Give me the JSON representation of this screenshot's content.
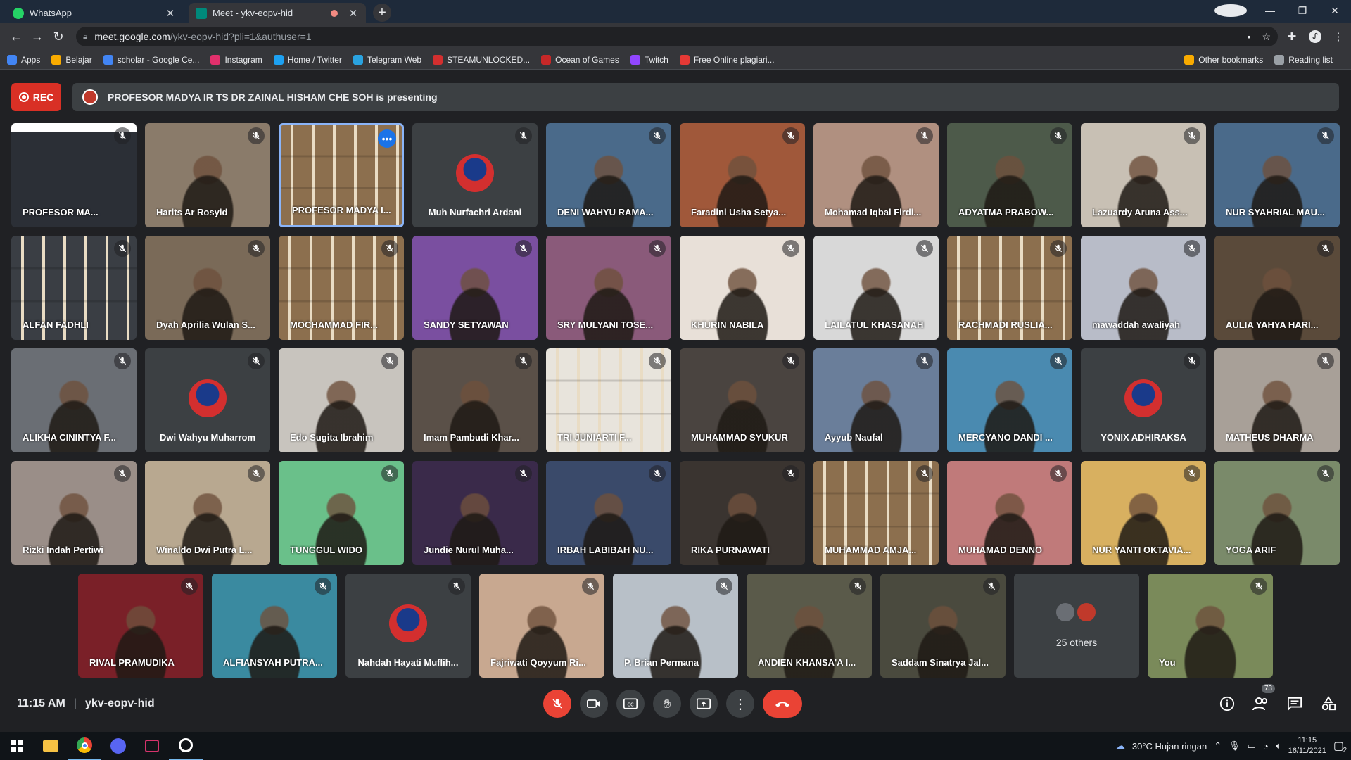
{
  "browser": {
    "tabs": [
      {
        "title": "WhatsApp",
        "color": "#25d366"
      },
      {
        "title": "Meet - ykv-eopv-hid",
        "color": "#00897b"
      }
    ],
    "url_host": "meet.google.com",
    "url_path": "/ykv-eopv-hid?pli=1&authuser=1",
    "bookmarks": [
      {
        "label": "Apps",
        "color": "#4285f4"
      },
      {
        "label": "Belajar",
        "color": "#f9ab00"
      },
      {
        "label": "scholar - Google Ce...",
        "color": "#4285f4"
      },
      {
        "label": "Instagram",
        "color": "#e1306c"
      },
      {
        "label": "Home / Twitter",
        "color": "#1da1f2"
      },
      {
        "label": "Telegram Web",
        "color": "#2aa3e0"
      },
      {
        "label": "STEAMUNLOCKED...",
        "color": "#d32f2f"
      },
      {
        "label": "Ocean of Games",
        "color": "#c62828"
      },
      {
        "label": "Twitch",
        "color": "#9146ff"
      },
      {
        "label": "Free Online plagiari...",
        "color": "#e53935"
      }
    ],
    "bookmarks_right": [
      {
        "label": "Other bookmarks",
        "color": "#f9ab00"
      },
      {
        "label": "Reading list",
        "color": "#9aa0a6"
      }
    ]
  },
  "meet": {
    "rec_label": "REC",
    "presenting_text": "PROFESOR MADYA IR TS DR ZAINAL HISHAM CHE SOH is presenting",
    "participants": [
      {
        "name": "PROFESOR MA...",
        "kind": "screen",
        "bg": "#2b2f36"
      },
      {
        "name": "Harits Ar Rosyid",
        "kind": "video",
        "bg": "#8a7b6a"
      },
      {
        "name": "PROFESOR MADYA I...",
        "kind": "shelf",
        "bg": "#8c6f4e",
        "presenting": true
      },
      {
        "name": "Muh Nurfachri Ardani",
        "kind": "avatar",
        "bg": "#3c4043"
      },
      {
        "name": "DENI WAHYU RAMA...",
        "kind": "video",
        "bg": "#4a6a8a"
      },
      {
        "name": "Faradini Usha Setya...",
        "kind": "video",
        "bg": "#a0583a"
      },
      {
        "name": "Mohamad Iqbal Firdi...",
        "kind": "video",
        "bg": "#b09080"
      },
      {
        "name": "ADYATMA PRABOW...",
        "kind": "video",
        "bg": "#4d5a4a"
      },
      {
        "name": "Lazuardy Aruna Ass...",
        "kind": "video",
        "bg": "#c8c0b4"
      },
      {
        "name": "NUR SYAHRIAL MAU...",
        "kind": "video",
        "bg": "#4a6a8a"
      },
      {
        "name": "ALFAN FADHLI",
        "kind": "shelf",
        "bg": "#3a3e44"
      },
      {
        "name": "Dyah Aprilia Wulan S...",
        "kind": "video",
        "bg": "#7a6a58"
      },
      {
        "name": "MOCHAMMAD FIR...",
        "kind": "shelf",
        "bg": "#8c6f4e"
      },
      {
        "name": "SANDY SETYAWAN",
        "kind": "video",
        "bg": "#7a4fa0"
      },
      {
        "name": "SRY MULYANI TOSE...",
        "kind": "video",
        "bg": "#8a5a7a"
      },
      {
        "name": "KHURIN NABILA",
        "kind": "video",
        "bg": "#e8e0d8"
      },
      {
        "name": "LAILATUL KHASANAH",
        "kind": "video",
        "bg": "#d8d8d8"
      },
      {
        "name": "RACHMADI RUSLIA...",
        "kind": "shelf",
        "bg": "#8c6f4e"
      },
      {
        "name": "mawaddah awaliyah",
        "kind": "video",
        "bg": "#b8bcc8"
      },
      {
        "name": "AULIA YAHYA HARI...",
        "kind": "video",
        "bg": "#5a4a3a"
      },
      {
        "name": "ALIKHA CININTYA F...",
        "kind": "video",
        "bg": "#6a6e74"
      },
      {
        "name": "Dwi Wahyu Muharrom",
        "kind": "avatar",
        "bg": "#3c4043"
      },
      {
        "name": "Edo Sugita Ibrahim",
        "kind": "video",
        "bg": "#c8c4be"
      },
      {
        "name": "Imam Pambudi Khar...",
        "kind": "video",
        "bg": "#5a5048"
      },
      {
        "name": "TRI JUNIARTI F...",
        "kind": "shelf-light",
        "bg": "#e8e4dc"
      },
      {
        "name": "MUHAMMAD SYUKUR",
        "kind": "video",
        "bg": "#4a4440"
      },
      {
        "name": "Ayyub Naufal",
        "kind": "video",
        "bg": "#6a7e9a"
      },
      {
        "name": "MERCYANO DANDI ...",
        "kind": "video",
        "bg": "#4a8ab0"
      },
      {
        "name": "YONIX ADHIRAKSA",
        "kind": "avatar",
        "bg": "#3c4043"
      },
      {
        "name": "MATHEUS DHARMA",
        "kind": "video",
        "bg": "#a8a098"
      },
      {
        "name": "Rizki Indah Pertiwi",
        "kind": "video",
        "bg": "#9a8e88"
      },
      {
        "name": "Winaldo Dwi Putra L...",
        "kind": "video",
        "bg": "#b8a890"
      },
      {
        "name": "TUNGGUL WIDO",
        "kind": "video",
        "bg": "#6ac08a"
      },
      {
        "name": "Jundie Nurul Muha...",
        "kind": "video",
        "bg": "#3a2a4a"
      },
      {
        "name": "IRBAH LABIBAH NU...",
        "kind": "video",
        "bg": "#3a4a6a"
      },
      {
        "name": "RIKA PURNAWATI",
        "kind": "video",
        "bg": "#3a3430"
      },
      {
        "name": "MUHAMMAD AMJA...",
        "kind": "shelf",
        "bg": "#8c6f4e"
      },
      {
        "name": "MUHAMAD DENNO",
        "kind": "video",
        "bg": "#c07a7a"
      },
      {
        "name": "NUR YANTI OKTAVIA...",
        "kind": "video",
        "bg": "#d8b060"
      },
      {
        "name": "YOGA ARIF",
        "kind": "video",
        "bg": "#7a8a6a"
      }
    ],
    "last_row": [
      {
        "name": "RIVAL PRAMUDIKA",
        "kind": "video",
        "bg": "#7a2028"
      },
      {
        "name": "ALFIANSYAH PUTRA...",
        "kind": "video",
        "bg": "#3a8aa0"
      },
      {
        "name": "Nahdah Hayati Muflih...",
        "kind": "avatar",
        "bg": "#3c4043"
      },
      {
        "name": "Fajriwati Qoyyum Ri...",
        "kind": "video",
        "bg": "#c8a890"
      },
      {
        "name": "P. Brian Permana",
        "kind": "video",
        "bg": "#b8c0c8"
      },
      {
        "name": "ANDIEN KHANSA'A I...",
        "kind": "video",
        "bg": "#5a5a4a"
      },
      {
        "name": "Saddam Sinatrya Jal...",
        "kind": "video",
        "bg": "#4a4a3e"
      },
      {
        "name": "25 others",
        "kind": "others",
        "bg": "#3c4043"
      },
      {
        "name": "You",
        "kind": "video",
        "bg": "#7a8a5a"
      }
    ],
    "time": "11:15 AM",
    "meeting_code": "ykv-eopv-hid",
    "people_count": "73"
  },
  "taskbar": {
    "weather": "30°C  Hujan ringan",
    "time": "11:15",
    "date": "16/11/2021",
    "notifications": "2"
  }
}
